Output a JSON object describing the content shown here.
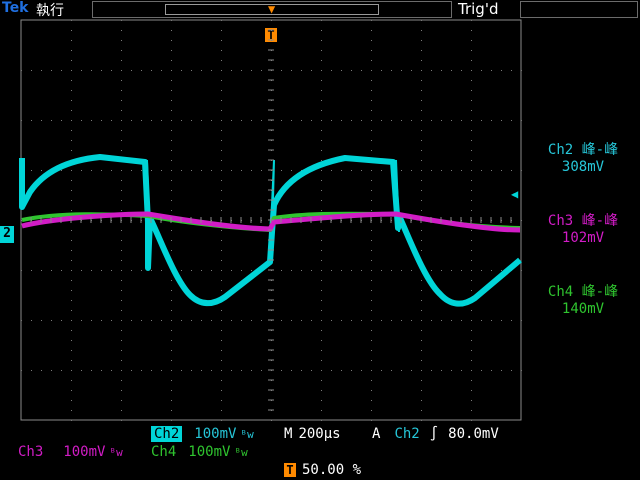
{
  "header": {
    "brand": "Tek",
    "run_state": "執行",
    "trigger_status": "Trig'd",
    "trigger_marker": "T"
  },
  "colors": {
    "ch2": "#00d5d8",
    "ch3": "#d21cc6",
    "ch4": "#2fc42f",
    "trigger": "#ff8a00",
    "grid": "#8a8a8a",
    "brand": "#1f6fe0"
  },
  "ground_marker": "2",
  "measurements": [
    {
      "label": "Ch2 峰-峰",
      "value": "308mV",
      "color": "#26c6d8"
    },
    {
      "label": "Ch3 峰-峰",
      "value": "102mV",
      "color": "#d21cc6"
    },
    {
      "label": "Ch4 峰-峰",
      "value": "140mV",
      "color": "#2fc42f"
    }
  ],
  "footer": {
    "ch2_name": "Ch2",
    "ch2_scale": "100mV",
    "ch2_bw": "ᴮw",
    "ch3_name": "Ch3",
    "ch3_scale": "100mV",
    "ch3_bw": "ᴮw",
    "ch4_name": "Ch4",
    "ch4_scale": "100mV",
    "ch4_bw": "ᴮw",
    "timebase_prefix": "M",
    "timebase": "200µs",
    "trigger_mode": "A",
    "trigger_source": "Ch2",
    "trigger_slope": "∫",
    "trigger_level": "80.0mV",
    "position_marker": "T",
    "position": "50.00 %"
  }
}
